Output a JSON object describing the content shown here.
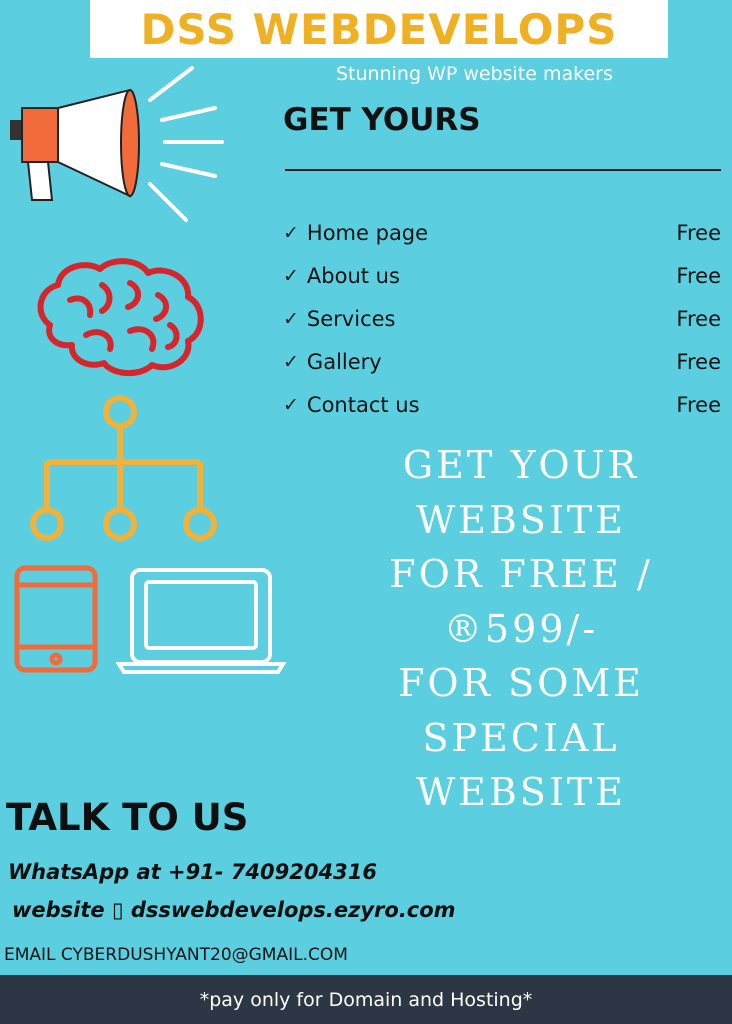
{
  "header": {
    "brand": "DSS WEBDEVELOPS",
    "tagline": "Stunning WP website makers"
  },
  "offer": {
    "heading": "GET YOURS",
    "check_symbol": "✓",
    "items": [
      {
        "label": "Home page",
        "price": "Free"
      },
      {
        "label": "About us",
        "price": "Free"
      },
      {
        "label": "Services",
        "price": "Free"
      },
      {
        "label": "Gallery",
        "price": "Free"
      },
      {
        "label": "Contact us",
        "price": "Free"
      }
    ]
  },
  "promo": {
    "lines": [
      "GET YOUR",
      "WEBSITE",
      "FOR FREE /",
      "®599/-",
      "FOR SOME",
      "SPECIAL",
      "WEBSITE"
    ]
  },
  "contact": {
    "title": "TALK TO US",
    "whatsapp": "WhatsApp at +91- 7409204316",
    "website": "website ▯  dsswebdevelops.ezyro.com",
    "email": "EMAIL CYBERDUSHYANT20@GMAIL.COM"
  },
  "footer": {
    "note": "*pay only for Domain and Hosting*"
  },
  "colors": {
    "background": "#5bcfe0",
    "brand": "#f0b023",
    "megaphone": "#f26b3a",
    "brain": "#d7262b",
    "network": "#f0b23a",
    "footer": "#2d3645"
  }
}
